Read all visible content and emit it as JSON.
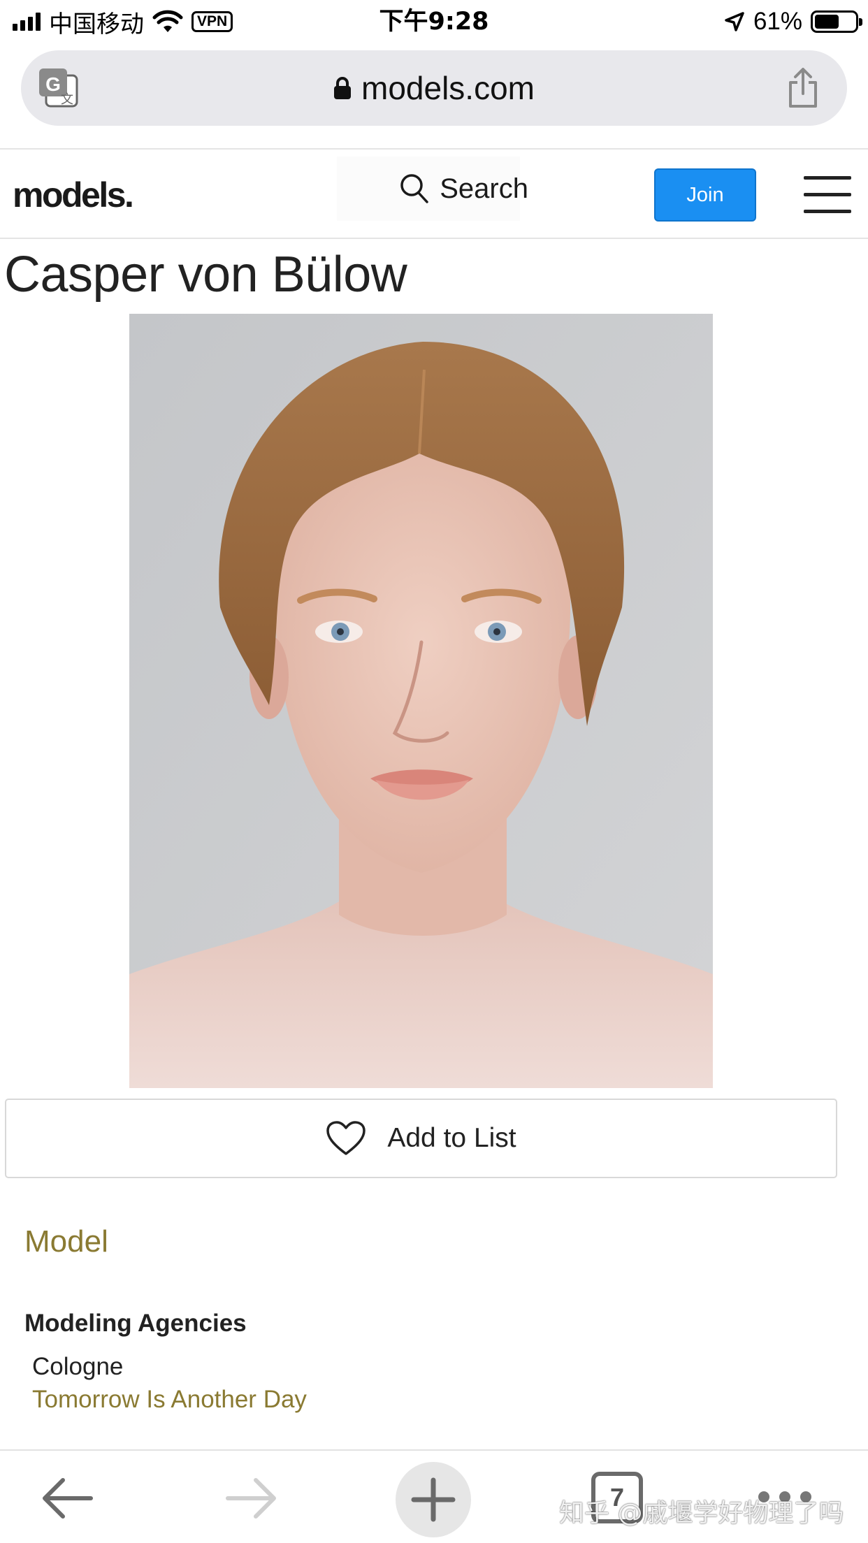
{
  "status_bar": {
    "carrier": "中国移动",
    "vpn_label": "VPN",
    "time": "下午9:28",
    "battery_percent": "61%",
    "battery_level": 0.61,
    "icons": [
      "signal-icon",
      "wifi-icon",
      "location-arrow-icon",
      "battery-icon"
    ]
  },
  "address_bar": {
    "url": "models.com",
    "icons": [
      "translate-icon",
      "lock-icon",
      "share-icon"
    ]
  },
  "site_header": {
    "logo": "models.",
    "search_label": "Search",
    "join_label": "Join",
    "icons": [
      "search-icon",
      "hamburger-menu-icon"
    ],
    "accent_color": "#1a8ff2"
  },
  "profile": {
    "name": "Casper von Bülow",
    "add_to_list_label": "Add to List",
    "category": "Model",
    "agencies_heading": "Modeling Agencies",
    "agencies": [
      {
        "city": "Cologne",
        "name": "Tomorrow Is Another Day"
      }
    ],
    "link_color": "#8a7a32"
  },
  "toolbar": {
    "tab_count": "7",
    "icons": [
      "back-arrow-icon",
      "forward-arrow-icon",
      "plus-icon",
      "tabs-icon",
      "more-dots-icon"
    ]
  },
  "watermark": "知乎 @戚堰学好物理了吗"
}
